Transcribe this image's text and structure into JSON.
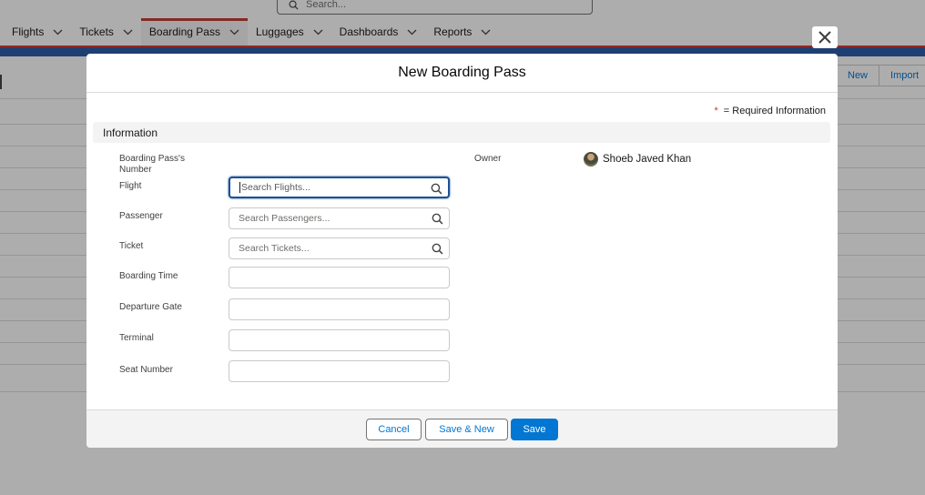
{
  "search": {
    "placeholder": "Search..."
  },
  "nav": {
    "items": [
      {
        "label": "Flights"
      },
      {
        "label": "Tickets"
      },
      {
        "label": "Boarding Pass",
        "active": true
      },
      {
        "label": "Luggages"
      },
      {
        "label": "Dashboards"
      },
      {
        "label": "Reports"
      }
    ]
  },
  "background_buttons": {
    "new": "New",
    "import": "Import"
  },
  "modal": {
    "title": "New Boarding Pass",
    "required_star": "*",
    "required_text": "= Required Information",
    "section": "Information",
    "fields": {
      "boarding_pass_number": {
        "label": "Boarding Pass's Number"
      },
      "flight": {
        "label": "Flight",
        "placeholder": "Search Flights..."
      },
      "passenger": {
        "label": "Passenger",
        "placeholder": "Search Passengers..."
      },
      "ticket": {
        "label": "Ticket",
        "placeholder": "Search Tickets..."
      },
      "boarding_time": {
        "label": "Boarding Time",
        "value": ""
      },
      "departure_gate": {
        "label": "Departure Gate",
        "value": ""
      },
      "terminal": {
        "label": "Terminal",
        "value": ""
      },
      "seat_number": {
        "label": "Seat Number",
        "value": ""
      }
    },
    "owner": {
      "label": "Owner",
      "name": "Shoeb Javed Khan"
    },
    "footer": {
      "cancel": "Cancel",
      "save_new": "Save & New",
      "save": "Save"
    }
  },
  "colors": {
    "accent": "#0176d3",
    "required": "#c23934",
    "focus": "#1b5297",
    "nav_active": "#c23934"
  },
  "icons": {
    "search": "search-icon",
    "close": "close-icon",
    "chevron": "chevron-down-icon"
  }
}
